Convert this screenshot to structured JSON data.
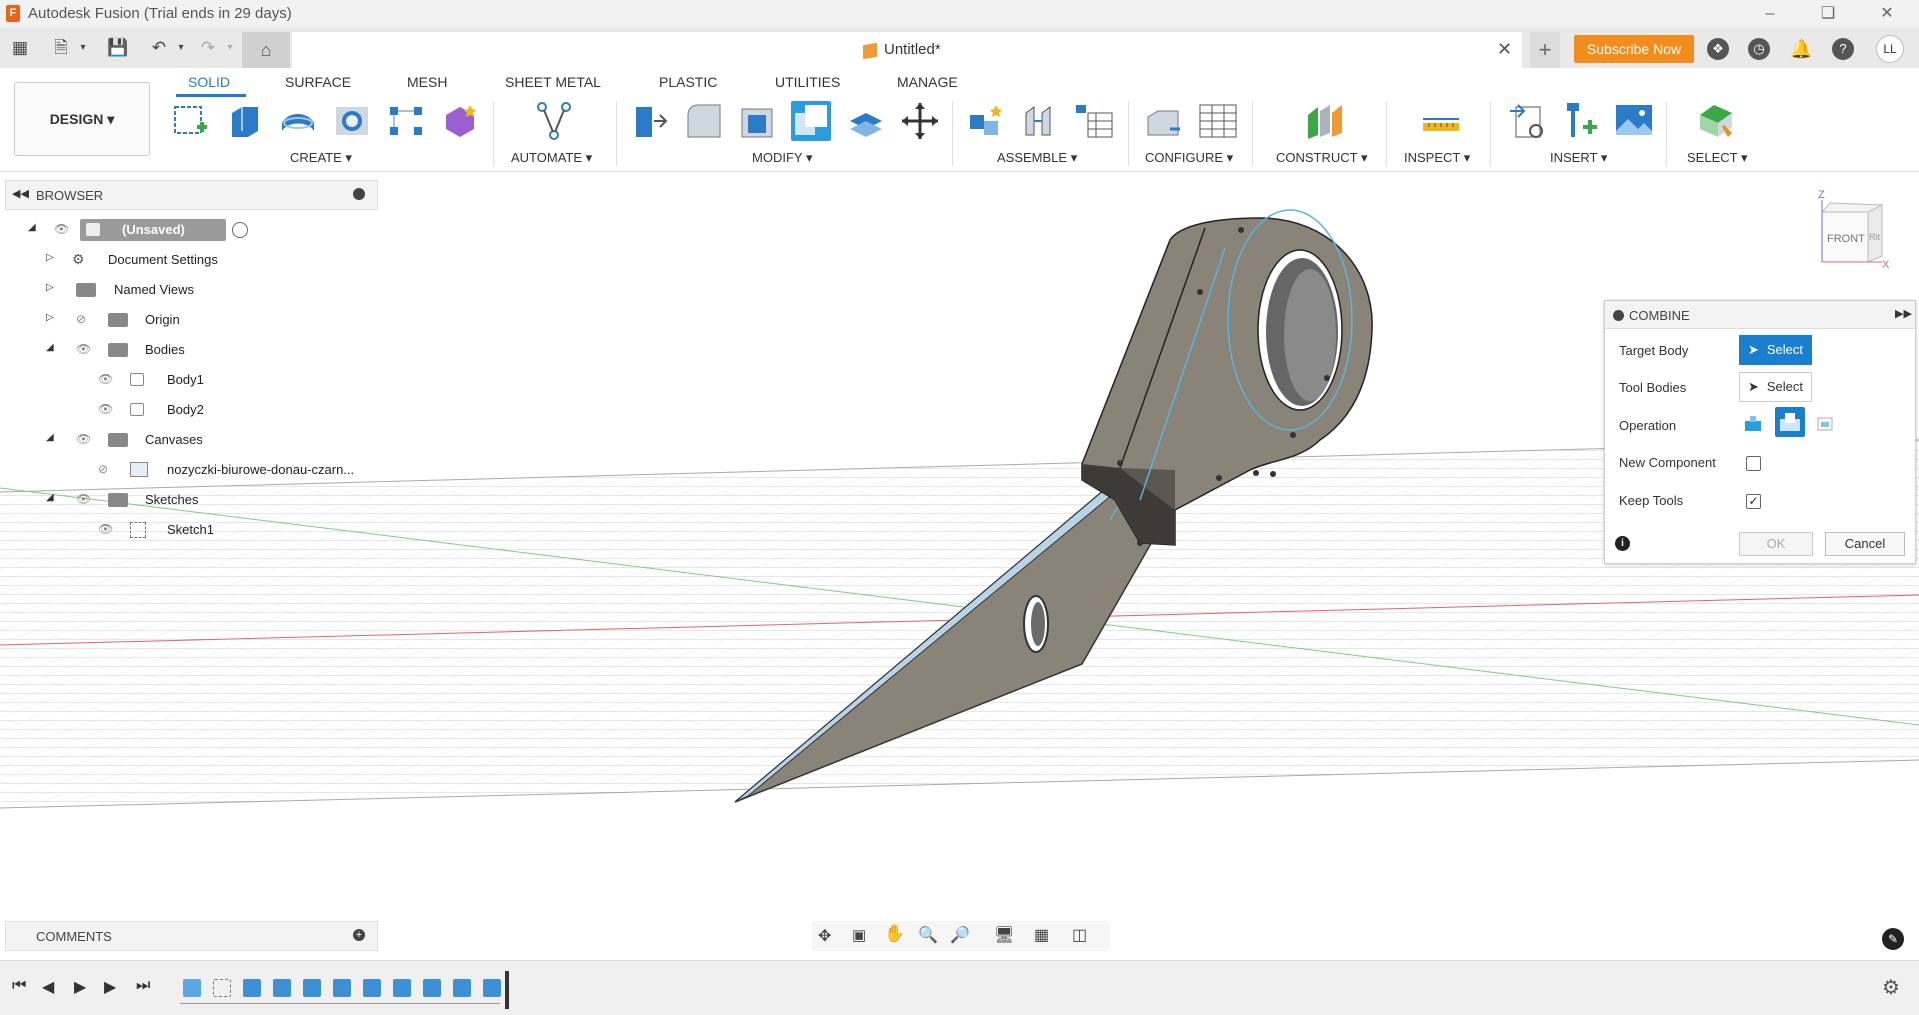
{
  "window": {
    "title": "Autodesk Fusion (Trial ends in 29 days)",
    "app_logo": "F"
  },
  "tabbar": {
    "document_title": "Untitled*",
    "subscribe_label": "Subscribe Now",
    "user_initials": "LL"
  },
  "toolbar": {
    "workspace_label": "DESIGN",
    "tabs": [
      "SOLID",
      "SURFACE",
      "MESH",
      "SHEET METAL",
      "PLASTIC",
      "UTILITIES",
      "MANAGE"
    ],
    "active_tab": "SOLID",
    "groups": [
      "CREATE",
      "AUTOMATE",
      "MODIFY",
      "ASSEMBLE",
      "CONFIGURE",
      "CONSTRUCT",
      "INSPECT",
      "INSERT",
      "SELECT"
    ]
  },
  "browser": {
    "title": "BROWSER",
    "items": [
      {
        "label": "(Unsaved)"
      },
      {
        "label": "Document Settings"
      },
      {
        "label": "Named Views"
      },
      {
        "label": "Origin"
      },
      {
        "label": "Bodies"
      },
      {
        "label": "Body1"
      },
      {
        "label": "Body2"
      },
      {
        "label": "Canvases"
      },
      {
        "label": "nozyczki-biurowe-donau-czarn..."
      },
      {
        "label": "Sketches"
      },
      {
        "label": "Sketch1"
      }
    ]
  },
  "viewcube": {
    "front_label": "FRONT",
    "right_label": "Rit",
    "z_label": "Z",
    "x_label": "X"
  },
  "combine": {
    "title": "COMBINE",
    "target_body_label": "Target Body",
    "tool_bodies_label": "Tool Bodies",
    "select_label": "Select",
    "operation_label": "Operation",
    "new_component_label": "New Component",
    "new_component_checked": false,
    "keep_tools_label": "Keep Tools",
    "keep_tools_checked": true,
    "ok_label": "OK",
    "cancel_label": "Cancel"
  },
  "comments": {
    "title": "COMMENTS"
  },
  "colors": {
    "accent": "#1a7fd0",
    "subscribe": "#f28c1a",
    "body": "#8a8378"
  }
}
